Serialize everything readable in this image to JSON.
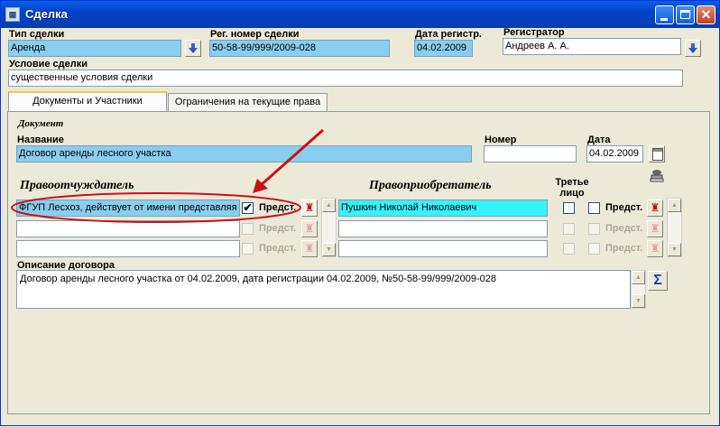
{
  "window": {
    "title": "Сделка",
    "icon": "app-icon"
  },
  "header": {
    "deal_type_label": "Тип сделки",
    "deal_type_value": "Аренда",
    "reg_number_label": "Рег. номер сделки",
    "reg_number_value": "50-58-99/999/2009-028",
    "reg_date_label": "Дата регистр.",
    "reg_date_value": "04.02.2009",
    "registrar_label": "Регистратор",
    "registrar_value": "Андреев А. А.",
    "condition_label": "Условие сделки",
    "condition_value": "существенные условия сделки"
  },
  "tabs": [
    {
      "label": "Документы и Участники",
      "active": true
    },
    {
      "label": "Ограничения на текущие права",
      "active": false
    }
  ],
  "document": {
    "section_label": "Документ",
    "name_label": "Название",
    "name_value": "Договор аренды лесного участка",
    "number_label": "Номер",
    "number_value": "",
    "date_label": "Дата",
    "date_value": "04.02.2009"
  },
  "alienators": {
    "heading": "Правоотчуждатель",
    "rows": [
      {
        "value": "ФГУП Лесхоз, действует от имени представляя",
        "checked": true,
        "check_label": "Предст."
      },
      {
        "value": "",
        "checked": false,
        "check_label": "Предст."
      },
      {
        "value": "",
        "checked": false,
        "check_label": "Предст."
      }
    ]
  },
  "acquirers": {
    "heading": "Правоприобретатель",
    "third_party_label": "Третье лицо",
    "rows": [
      {
        "value": "Пушкин Николай Николаевич",
        "third": false,
        "checked": false,
        "check_label": "Предст."
      },
      {
        "value": "",
        "third": false,
        "checked": false,
        "check_label": "Предст."
      },
      {
        "value": "",
        "third": false,
        "checked": false,
        "check_label": "Предст."
      }
    ]
  },
  "description": {
    "label": "Описание договора",
    "value": "Договор аренды лесного участка от 04.02.2009, дата регистрации 04.02.2009, №50-58-99/999/2009-028"
  },
  "icons": {
    "dropdown": "arrow-down-icon",
    "calendar": "calendar-icon",
    "stamp": "stamp-icon",
    "person": "person-icon",
    "sigma": "sigma-icon"
  },
  "colors": {
    "titlebar": "#0443c7",
    "highlight_field": "#87cef0",
    "selected_field": "#33f3ff",
    "annotation": "#cc1111"
  }
}
